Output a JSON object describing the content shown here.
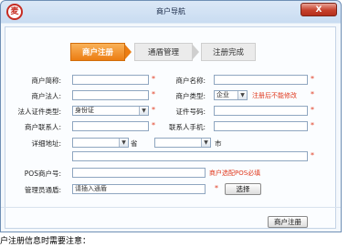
{
  "window": {
    "logo_text": "麦",
    "title": "商户导航",
    "close_label": "X"
  },
  "steps": [
    {
      "label": "商户注册",
      "active": true
    },
    {
      "label": "通盾管理",
      "active": false
    },
    {
      "label": "注册完成",
      "active": false
    }
  ],
  "form": {
    "merchant_short_name": {
      "label": "商户简称:",
      "value": ""
    },
    "merchant_name": {
      "label": "商户名称:",
      "value": ""
    },
    "legal_person": {
      "label": "商户法人:",
      "value": ""
    },
    "merchant_type": {
      "label": "商户类型:",
      "value": "企业",
      "hint": "注册后不能修改"
    },
    "legal_id_type": {
      "label": "法人证件类型:",
      "value": "身份证"
    },
    "id_number": {
      "label": "证件号码:",
      "value": ""
    },
    "contact_person": {
      "label": "商户联系人:",
      "value": ""
    },
    "contact_mobile": {
      "label": "联系人手机:",
      "value": ""
    },
    "address": {
      "label": "详细地址:",
      "province_unit": "省",
      "city_unit": "市",
      "detail_value": ""
    },
    "pos_number": {
      "label": "POS商户号:",
      "value": "",
      "hint": "商户选配POS必填"
    },
    "manage_shield": {
      "label": "管理员通盾:",
      "placeholder": "请插入通盾",
      "choose_label": "选择"
    }
  },
  "footer": {
    "register_button": "商户注册"
  },
  "bottom_text": "户注册信息时需要注意："
}
